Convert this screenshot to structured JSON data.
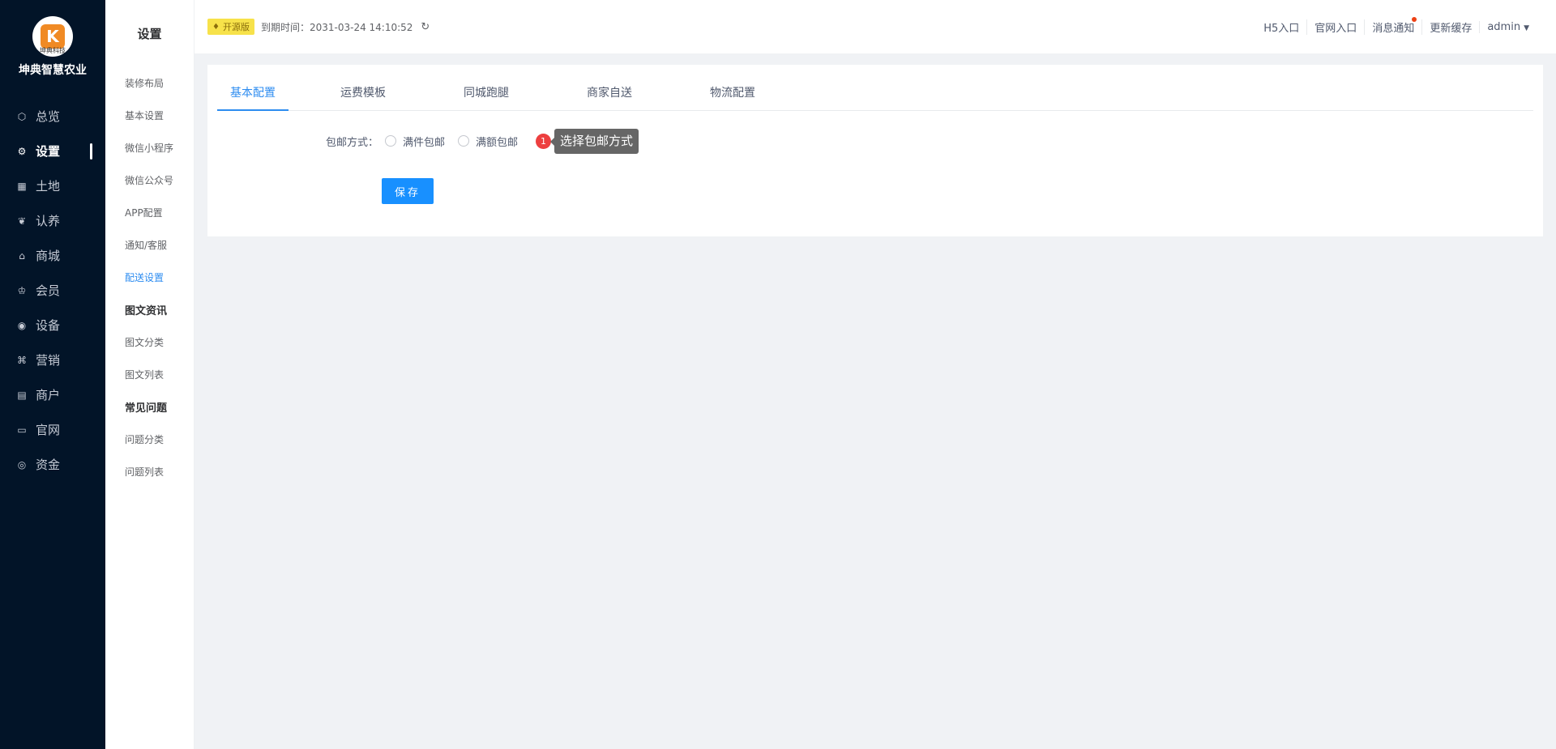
{
  "brand": {
    "name": "坤典智慧农业",
    "logo_caption": "坤典科技",
    "logo_letter": "K"
  },
  "nav": [
    {
      "label": "总览",
      "icon": "dashboard-icon",
      "glyph": "⬡",
      "active": false
    },
    {
      "label": "设置",
      "icon": "gear-icon",
      "glyph": "⚙",
      "active": true
    },
    {
      "label": "土地",
      "icon": "grid-icon",
      "glyph": "▦",
      "active": false
    },
    {
      "label": "认养",
      "icon": "sprout-icon",
      "glyph": "❦",
      "active": false
    },
    {
      "label": "商城",
      "icon": "shop-icon",
      "glyph": "⌂",
      "active": false
    },
    {
      "label": "会员",
      "icon": "crown-icon",
      "glyph": "♔",
      "active": false
    },
    {
      "label": "设备",
      "icon": "location-icon",
      "glyph": "◉",
      "active": false
    },
    {
      "label": "营销",
      "icon": "command-icon",
      "glyph": "⌘",
      "active": false
    },
    {
      "label": "商户",
      "icon": "merchant-icon",
      "glyph": "▤",
      "active": false
    },
    {
      "label": "官网",
      "icon": "window-icon",
      "glyph": "▭",
      "active": false
    },
    {
      "label": "资金",
      "icon": "coin-icon",
      "glyph": "◎",
      "active": false
    }
  ],
  "submenu": {
    "title": "设置",
    "items": [
      {
        "type": "item",
        "label": "装修布局",
        "active": false
      },
      {
        "type": "item",
        "label": "基本设置",
        "active": false
      },
      {
        "type": "item",
        "label": "微信小程序",
        "active": false
      },
      {
        "type": "item",
        "label": "微信公众号",
        "active": false
      },
      {
        "type": "item",
        "label": "APP配置",
        "active": false
      },
      {
        "type": "item",
        "label": "通知/客服",
        "active": false
      },
      {
        "type": "item",
        "label": "配送设置",
        "active": true
      },
      {
        "type": "group",
        "label": "图文资讯"
      },
      {
        "type": "item",
        "label": "图文分类",
        "active": false
      },
      {
        "type": "item",
        "label": "图文列表",
        "active": false
      },
      {
        "type": "group",
        "label": "常见问题"
      },
      {
        "type": "item",
        "label": "问题分类",
        "active": false
      },
      {
        "type": "item",
        "label": "问题列表",
        "active": false
      }
    ]
  },
  "header": {
    "edition": "开源版",
    "expire_text": "到期时间：2031-03-24 14:10:52",
    "links": [
      "H5入口",
      "官网入口",
      "消息通知",
      "更新缓存"
    ],
    "user": "admin"
  },
  "tabs": [
    "基本配置",
    "运费模板",
    "同城跑腿",
    "商家自送",
    "物流配置"
  ],
  "active_tab": 0,
  "form": {
    "label": "包邮方式：",
    "options": [
      "满件包邮",
      "满额包邮"
    ],
    "step_number": "1",
    "tooltip": "选择包邮方式",
    "save_label": "保存"
  },
  "colors": {
    "sidebar": "#021428",
    "accent": "#2d8cf0",
    "button": "#1890ff",
    "badge": "#f7e24a"
  }
}
